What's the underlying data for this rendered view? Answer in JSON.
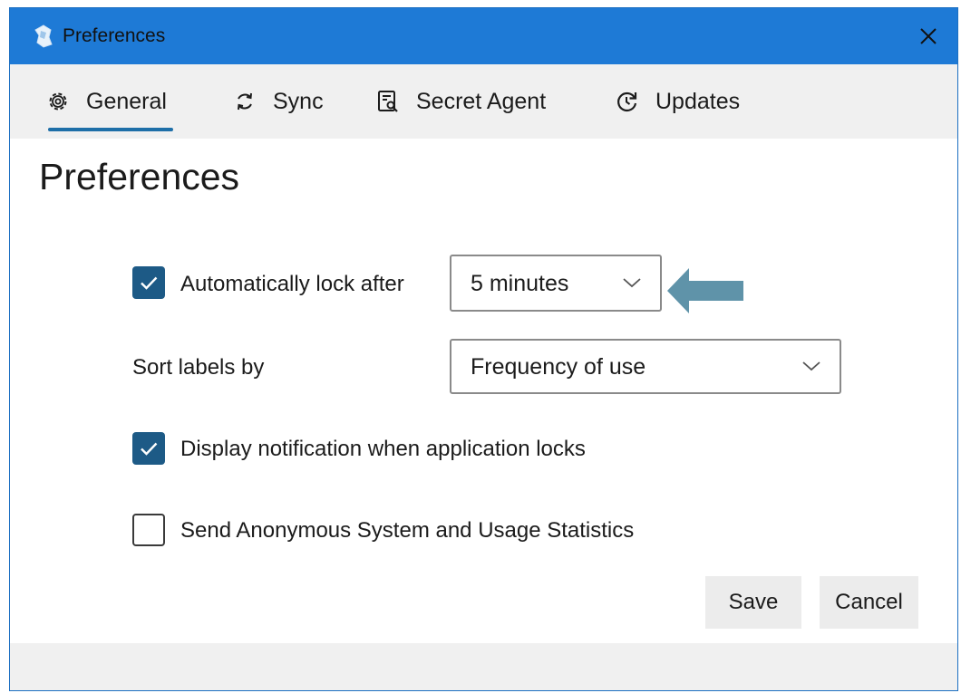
{
  "window": {
    "title": "Preferences"
  },
  "tabs": [
    {
      "label": "General",
      "icon": "gear-icon",
      "selected": true
    },
    {
      "label": "Sync",
      "icon": "sync-icon",
      "selected": false
    },
    {
      "label": "Secret Agent",
      "icon": "secret-agent-icon",
      "selected": false
    },
    {
      "label": "Updates",
      "icon": "updates-icon",
      "selected": false
    }
  ],
  "page": {
    "title": "Preferences"
  },
  "settings": {
    "auto_lock": {
      "label": "Automatically lock after",
      "checked": true,
      "value": "5 minutes"
    },
    "sort_labels": {
      "label": "Sort labels by",
      "value": "Frequency of use"
    },
    "notify_lock": {
      "label": "Display notification when application locks",
      "checked": true
    },
    "send_stats": {
      "label": "Send Anonymous System and Usage Statistics",
      "checked": false
    }
  },
  "buttons": {
    "save": "Save",
    "cancel": "Cancel"
  },
  "colors": {
    "titlebar": "#1e7ad6",
    "accent": "#1d5a86",
    "annotation_arrow": "#5f93a9",
    "tab_underline": "#1e6fa8"
  }
}
